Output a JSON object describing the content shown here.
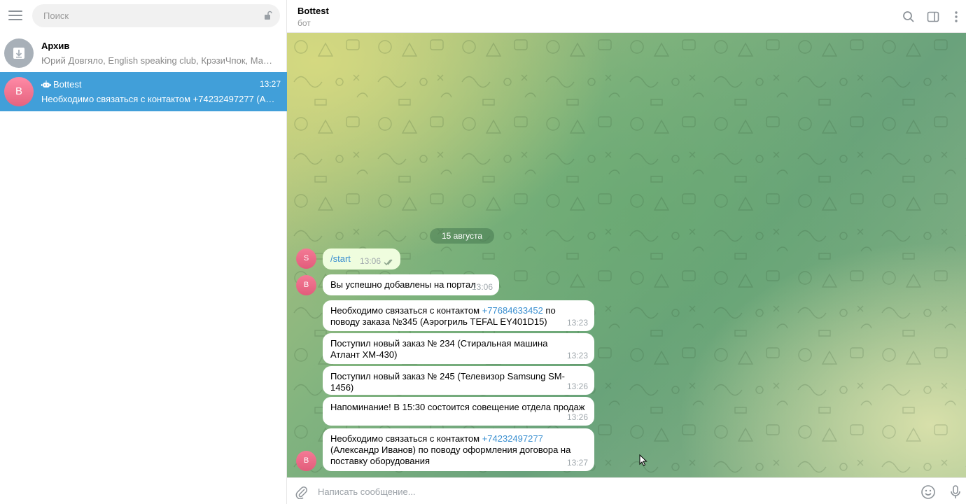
{
  "sidebar": {
    "search_placeholder": "Поиск",
    "chats": [
      {
        "name": "Архив",
        "preview": "Юрий Довгяло, English speaking club, КрэзиЧпок, Мафия в ..."
      },
      {
        "name": "Bottest",
        "avatar_letter": "B",
        "time": "13:27",
        "preview": "Необходимо связаться с контактом +74232497277 (Алекса..."
      }
    ]
  },
  "header": {
    "title": "Bottest",
    "subtitle": "бот"
  },
  "chat": {
    "date_label": "15 августа",
    "messages": [
      {
        "avatar": "S",
        "command": "/start",
        "time": "13:06"
      },
      {
        "avatar": "B",
        "text": "Вы успешно добавлены на портал",
        "time": "13:06"
      },
      {
        "text_before": "Необходимо связаться с контактом ",
        "phone": "+77684633452",
        "text_after": " по поводу заказа №345  (Аэрогриль TEFAL EY401D15)",
        "time": "13:23"
      },
      {
        "text": "Поступил новый заказ № 234 (Стиральная машина Атлант ХМ-430)",
        "time": "13:23"
      },
      {
        "text": "Поступил новый заказ № 245 (Телевизор Samsung SM-1456)",
        "time": "13:26"
      },
      {
        "text": "Напоминание! В 15:30 состоится совещение отдела продаж",
        "time": "13:26"
      },
      {
        "avatar": "B",
        "text_before": "Необходимо связаться с контактом ",
        "phone": "+74232497277",
        "text_after": " (Александр Иванов) по поводу оформления договора на поставку оборудования",
        "time": "13:27"
      }
    ]
  },
  "composer": {
    "placeholder": "Написать сообщение..."
  },
  "colors": {
    "accent": "#419fd9",
    "link": "#3a8fd0",
    "avatar_pink": "#e5637e"
  },
  "icons": [
    "menu-icon",
    "lock-icon",
    "archive-icon",
    "bot-icon",
    "search-icon",
    "sidebar-toggle-icon",
    "more-icon",
    "double-check-icon",
    "attach-icon",
    "emoji-icon",
    "mic-icon",
    "mouse-cursor-icon"
  ]
}
